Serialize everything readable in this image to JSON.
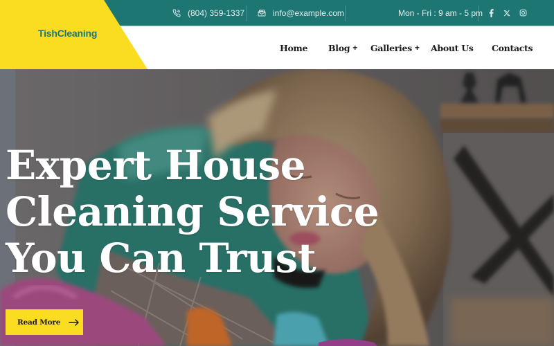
{
  "brand": {
    "name": "TishCleaning",
    "colors": {
      "primary": "#1d7672",
      "accent": "#fadd20",
      "text": "#1b1b1b"
    }
  },
  "topbar": {
    "phone": {
      "icon": "phone-icon",
      "text": "(804) 359-1337"
    },
    "email": {
      "icon": "mail-icon",
      "text": "info@example.com"
    },
    "hours": "Mon - Fri : 9 am - 5 pm",
    "social": [
      {
        "name": "facebook",
        "icon": "facebook-icon"
      },
      {
        "name": "x",
        "icon": "x-icon"
      },
      {
        "name": "instagram",
        "icon": "instagram-icon"
      }
    ]
  },
  "nav": {
    "items": [
      {
        "label": "Home",
        "has_submenu": false
      },
      {
        "label": "Blog",
        "has_submenu": true,
        "submenu_indicator": "+"
      },
      {
        "label": "Galleries",
        "has_submenu": true,
        "submenu_indicator": "+"
      },
      {
        "label": "About Us",
        "has_submenu": false
      },
      {
        "label": "Contacts",
        "has_submenu": false
      }
    ]
  },
  "hero": {
    "title_lines": [
      "Expert House",
      "Cleaning Service",
      "You Can Trust"
    ],
    "cta": {
      "label": "Read More",
      "icon": "arrow-right-icon"
    }
  }
}
